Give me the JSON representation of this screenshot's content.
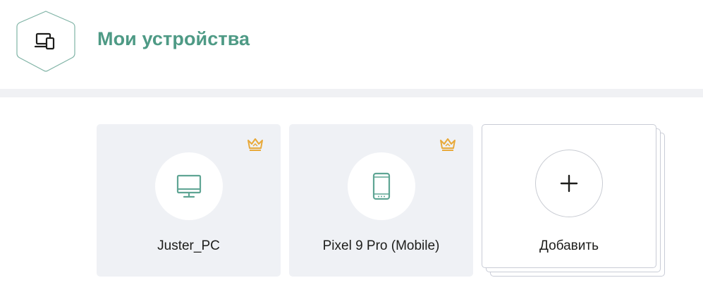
{
  "header": {
    "title": "Мои устройства",
    "icon": "devices-icon",
    "title_color": "#4e9a85"
  },
  "devices": [
    {
      "name": "Juster_PC",
      "icon": "monitor-icon",
      "premium_icon": "crown-icon"
    },
    {
      "name": "Pixel 9 Pro (Mobile)",
      "icon": "smartphone-icon",
      "premium_icon": "crown-icon"
    }
  ],
  "add_card": {
    "label": "Добавить",
    "icon": "plus-icon"
  },
  "colors": {
    "accent": "#4e9a85",
    "crown": "#e8a93a",
    "card_bg": "#eff1f5"
  }
}
